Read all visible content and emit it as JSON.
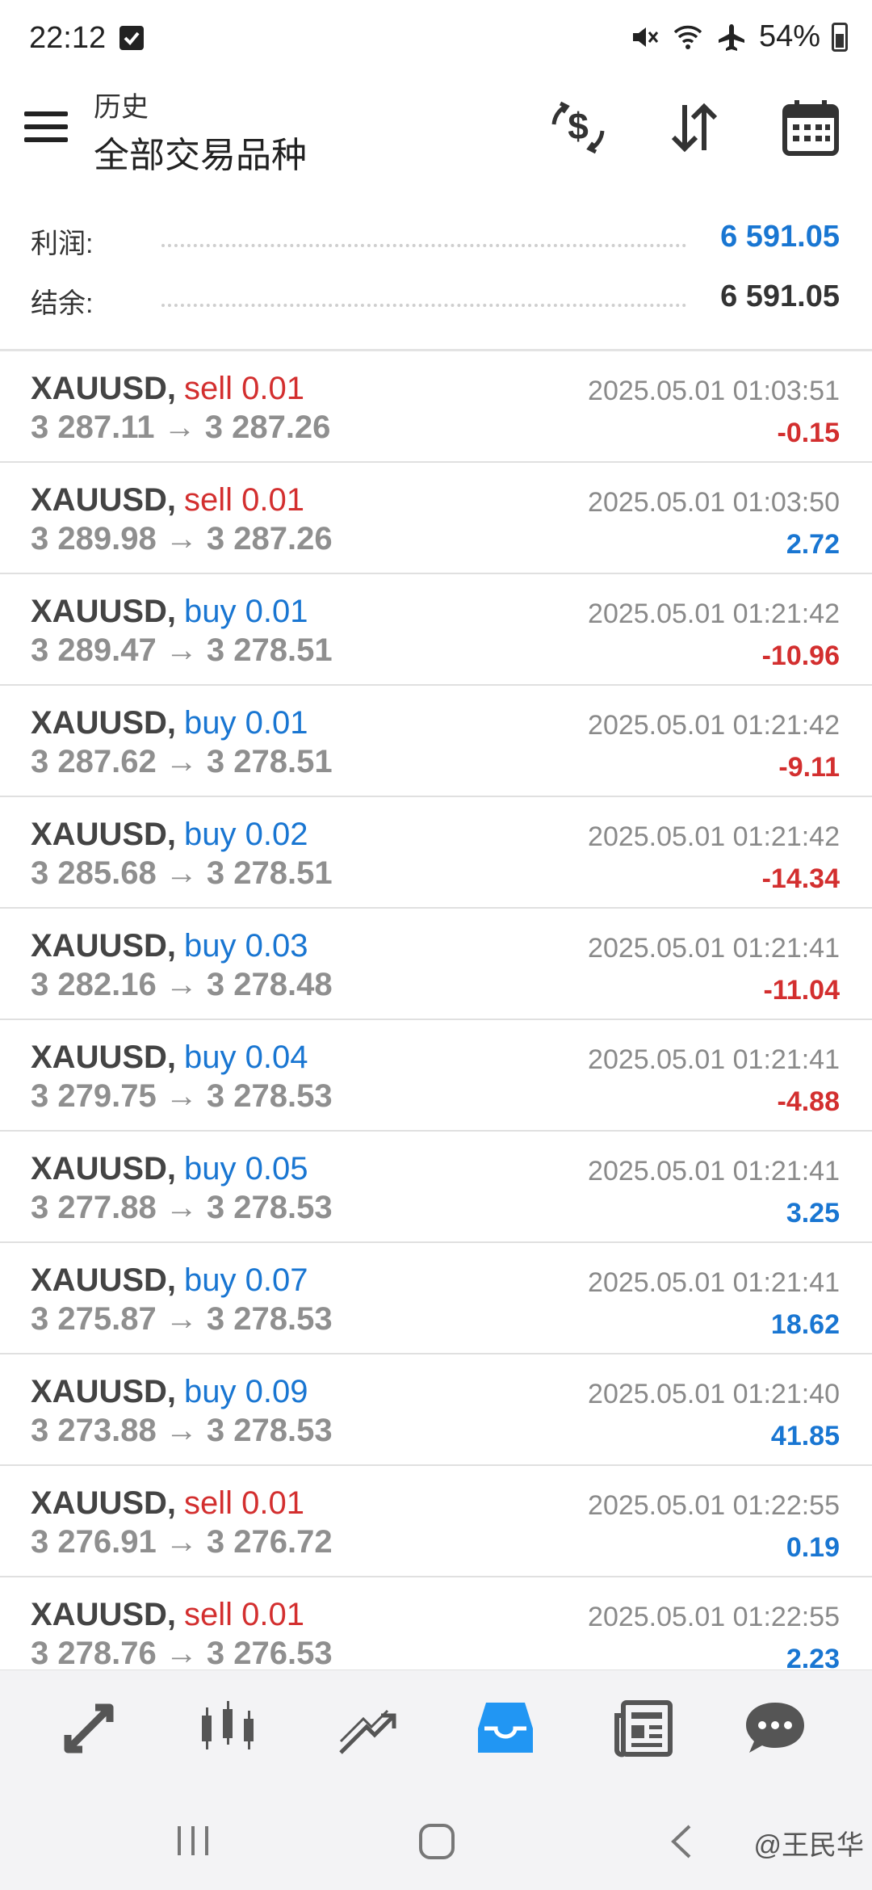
{
  "status_bar": {
    "time": "22:12",
    "battery": "54%",
    "icons": [
      "check-box-icon",
      "mute-icon",
      "wifi-icon",
      "airplane-icon",
      "battery-icon"
    ]
  },
  "toolbar": {
    "subtitle": "历史",
    "title": "全部交易品种",
    "icons": [
      "menu-icon",
      "currency-exchange-icon",
      "sort-icon",
      "calendar-icon"
    ]
  },
  "summary": {
    "profit_label": "利润:",
    "profit_value": "6 591.05",
    "balance_label": "结余:",
    "balance_value": "6 591.05"
  },
  "trades": [
    {
      "symbol": "XAUUSD,",
      "side": "sell 0.01",
      "side_type": "sell",
      "prices": "3 287.11 → 3 287.26",
      "time": "2025.05.01 01:03:51",
      "profit": "-0.15",
      "profit_sign": "neg"
    },
    {
      "symbol": "XAUUSD,",
      "side": "sell 0.01",
      "side_type": "sell",
      "prices": "3 289.98 → 3 287.26",
      "time": "2025.05.01 01:03:50",
      "profit": "2.72",
      "profit_sign": "pos"
    },
    {
      "symbol": "XAUUSD,",
      "side": "buy 0.01",
      "side_type": "buy",
      "prices": "3 289.47 → 3 278.51",
      "time": "2025.05.01 01:21:42",
      "profit": "-10.96",
      "profit_sign": "neg"
    },
    {
      "symbol": "XAUUSD,",
      "side": "buy 0.01",
      "side_type": "buy",
      "prices": "3 287.62 → 3 278.51",
      "time": "2025.05.01 01:21:42",
      "profit": "-9.11",
      "profit_sign": "neg"
    },
    {
      "symbol": "XAUUSD,",
      "side": "buy 0.02",
      "side_type": "buy",
      "prices": "3 285.68 → 3 278.51",
      "time": "2025.05.01 01:21:42",
      "profit": "-14.34",
      "profit_sign": "neg"
    },
    {
      "symbol": "XAUUSD,",
      "side": "buy 0.03",
      "side_type": "buy",
      "prices": "3 282.16 → 3 278.48",
      "time": "2025.05.01 01:21:41",
      "profit": "-11.04",
      "profit_sign": "neg"
    },
    {
      "symbol": "XAUUSD,",
      "side": "buy 0.04",
      "side_type": "buy",
      "prices": "3 279.75 → 3 278.53",
      "time": "2025.05.01 01:21:41",
      "profit": "-4.88",
      "profit_sign": "neg"
    },
    {
      "symbol": "XAUUSD,",
      "side": "buy 0.05",
      "side_type": "buy",
      "prices": "3 277.88 → 3 278.53",
      "time": "2025.05.01 01:21:41",
      "profit": "3.25",
      "profit_sign": "pos"
    },
    {
      "symbol": "XAUUSD,",
      "side": "buy 0.07",
      "side_type": "buy",
      "prices": "3 275.87 → 3 278.53",
      "time": "2025.05.01 01:21:41",
      "profit": "18.62",
      "profit_sign": "pos"
    },
    {
      "symbol": "XAUUSD,",
      "side": "buy 0.09",
      "side_type": "buy",
      "prices": "3 273.88 → 3 278.53",
      "time": "2025.05.01 01:21:40",
      "profit": "41.85",
      "profit_sign": "pos"
    },
    {
      "symbol": "XAUUSD,",
      "side": "sell 0.01",
      "side_type": "sell",
      "prices": "3 276.91 → 3 276.72",
      "time": "2025.05.01 01:22:55",
      "profit": "0.19",
      "profit_sign": "pos"
    },
    {
      "symbol": "XAUUSD,",
      "side": "sell 0.01",
      "side_type": "sell",
      "prices": "3 278.76 → 3 276.53",
      "time": "2025.05.01 01:22:55",
      "profit": "2.23",
      "profit_sign": "pos"
    }
  ],
  "bottom_nav": [
    {
      "name": "quotes-icon",
      "active": false
    },
    {
      "name": "chart-icon",
      "active": false
    },
    {
      "name": "trade-icon",
      "active": false
    },
    {
      "name": "history-icon",
      "active": true
    },
    {
      "name": "news-icon",
      "active": false
    },
    {
      "name": "chat-icon",
      "active": false
    }
  ],
  "system_bar": {
    "watermark": "@王民华"
  },
  "colors": {
    "sell": "#d32f2f",
    "buy": "#1976d2",
    "negative": "#d32f2f",
    "positive": "#1976d2",
    "active_nav": "#2196f3",
    "inactive_nav": "#555555"
  }
}
